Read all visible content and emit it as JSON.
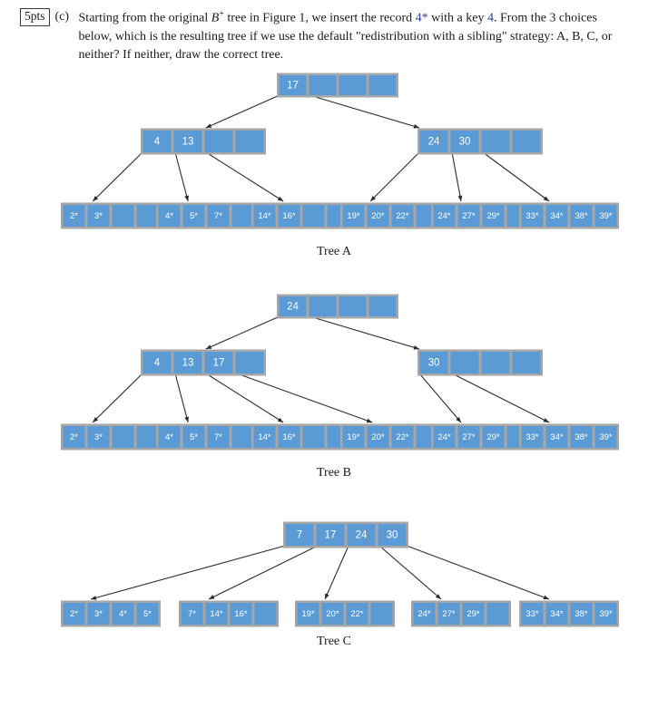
{
  "question": {
    "points_badge": "5pts",
    "part_label": "(c)",
    "text_part_1": "Starting from the original ",
    "math_b": "B",
    "math_sup": "+",
    "text_part_2": " tree in Figure 1, we insert the record ",
    "record": "4*",
    "text_part_3": " with a key ",
    "key": "4",
    "text_part_4": ". From the 3 choices below, which is the resulting tree if we use the default \"redistribution with a sibling\" strategy: A, B, C, or neither? If neither, draw the correct tree."
  },
  "colors": {
    "cell_fill": "#5b9bd5",
    "node_frame": "#a6a6a6",
    "cell_text": "#ffffff",
    "edge": "#2b2b2b",
    "accent_blue": "#2a3c9a"
  },
  "trees": [
    {
      "id": "tree-a",
      "caption": "Tree A",
      "root": {
        "cells": [
          "17",
          "",
          "",
          ""
        ]
      },
      "internal": [
        {
          "cells": [
            "4",
            "13",
            "",
            ""
          ]
        },
        {
          "cells": [
            "24",
            "30",
            "",
            ""
          ]
        }
      ],
      "leaves": [
        {
          "cells": [
            "2*",
            "3*",
            "",
            ""
          ]
        },
        {
          "cells": [
            "4*",
            "5*",
            "7*",
            ""
          ]
        },
        {
          "cells": [
            "14*",
            "16*",
            "",
            ""
          ]
        },
        {
          "cells": [
            "19*",
            "20*",
            "22*",
            ""
          ]
        },
        {
          "cells": [
            "24*",
            "27*",
            "29*",
            ""
          ]
        },
        {
          "cells": [
            "33*",
            "34*",
            "38*",
            "39*"
          ]
        }
      ]
    },
    {
      "id": "tree-b",
      "caption": "Tree B",
      "root": {
        "cells": [
          "24",
          "",
          "",
          ""
        ]
      },
      "internal": [
        {
          "cells": [
            "4",
            "13",
            "17",
            ""
          ]
        },
        {
          "cells": [
            "30",
            "",
            "",
            ""
          ]
        }
      ],
      "leaves": [
        {
          "cells": [
            "2*",
            "3*",
            "",
            ""
          ]
        },
        {
          "cells": [
            "4*",
            "5*",
            "7*",
            ""
          ]
        },
        {
          "cells": [
            "14*",
            "16*",
            "",
            ""
          ]
        },
        {
          "cells": [
            "19*",
            "20*",
            "22*",
            ""
          ]
        },
        {
          "cells": [
            "24*",
            "27*",
            "29*",
            ""
          ]
        },
        {
          "cells": [
            "33*",
            "34*",
            "38*",
            "39*"
          ]
        }
      ]
    },
    {
      "id": "tree-c",
      "caption": "Tree C",
      "root": {
        "cells": [
          "7",
          "17",
          "24",
          "30"
        ]
      },
      "internal": [],
      "leaves": [
        {
          "cells": [
            "2*",
            "3*",
            "4*",
            "5*"
          ]
        },
        {
          "cells": [
            "7*",
            "14*",
            "16*",
            ""
          ]
        },
        {
          "cells": [
            "19*",
            "20*",
            "22*",
            ""
          ]
        },
        {
          "cells": [
            "24*",
            "27*",
            "29*",
            ""
          ]
        },
        {
          "cells": [
            "33*",
            "34*",
            "38*",
            "39*"
          ]
        }
      ]
    }
  ]
}
